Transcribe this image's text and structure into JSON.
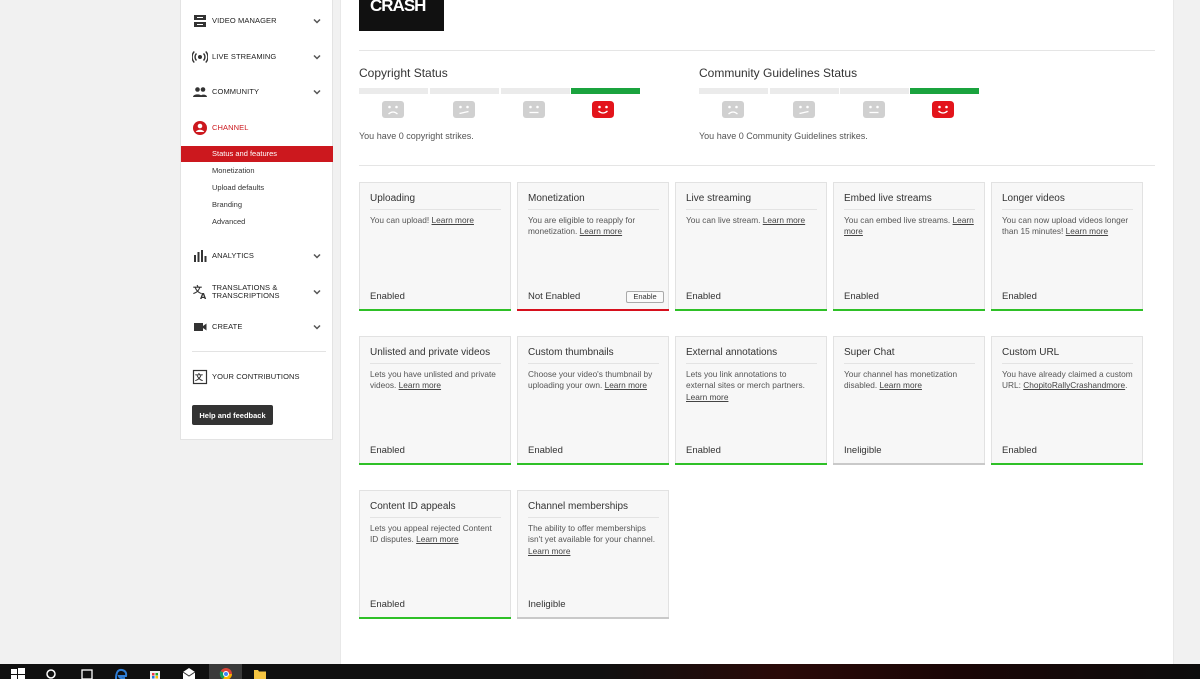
{
  "sidebar": {
    "items": [
      {
        "key": "video-manager",
        "label": "VIDEO MANAGER",
        "icon": "video-manager-icon",
        "expandable": true
      },
      {
        "key": "live-streaming",
        "label": "LIVE STREAMING",
        "icon": "live-streaming-icon",
        "expandable": true
      },
      {
        "key": "community",
        "label": "COMMUNITY",
        "icon": "community-icon",
        "expandable": true
      },
      {
        "key": "channel",
        "label": "CHANNEL",
        "icon": "channel-icon",
        "expandable": false,
        "active": true
      },
      {
        "key": "analytics",
        "label": "ANALYTICS",
        "icon": "analytics-icon",
        "expandable": true
      },
      {
        "key": "translations",
        "label": "TRANSLATIONS & TRANSCRIPTIONS",
        "icon": "translate-icon",
        "expandable": true
      },
      {
        "key": "create",
        "label": "CREATE",
        "icon": "create-icon",
        "expandable": true
      }
    ],
    "channel_subitems": [
      {
        "label": "Status and features",
        "active": true
      },
      {
        "label": "Monetization"
      },
      {
        "label": "Upload defaults"
      },
      {
        "label": "Branding"
      },
      {
        "label": "Advanced"
      }
    ],
    "contributions_label": "YOUR CONTRIBUTIONS",
    "help_button": "Help and feedback"
  },
  "main": {
    "logo_text": "CRASH",
    "copyright": {
      "title": "Copyright Status",
      "text": "You have 0 copyright strikes."
    },
    "community_guidelines": {
      "title": "Community Guidelines Status",
      "text": "You have 0 Community Guidelines strikes."
    },
    "cards": [
      {
        "title": "Uploading",
        "desc": "You can upload!",
        "link": "Learn more",
        "status": "Enabled",
        "state": "enabled"
      },
      {
        "title": "Monetization",
        "desc": "You are eligible to reapply for monetization.",
        "link": "Learn more",
        "status": "Not Enabled",
        "state": "notenabled",
        "button": "Enable"
      },
      {
        "title": "Live streaming",
        "desc": "You can live stream.",
        "link": "Learn more",
        "status": "Enabled",
        "state": "enabled"
      },
      {
        "title": "Embed live streams",
        "desc": "You can embed live streams.",
        "link": "Learn more",
        "status": "Enabled",
        "state": "enabled"
      },
      {
        "title": "Longer videos",
        "desc": "You can now upload videos longer than 15 minutes!",
        "link": "Learn more",
        "status": "Enabled",
        "state": "enabled"
      },
      {
        "title": "Unlisted and private videos",
        "desc": "Lets you have unlisted and private videos.",
        "link": "Learn more",
        "status": "Enabled",
        "state": "enabled"
      },
      {
        "title": "Custom thumbnails",
        "desc": "Choose your video's thumbnail by uploading your own.",
        "link": "Learn more",
        "status": "Enabled",
        "state": "enabled"
      },
      {
        "title": "External annotations",
        "desc": "Lets you link annotations to external sites or merch partners.",
        "link": "Learn more",
        "status": "Enabled",
        "state": "enabled"
      },
      {
        "title": "Super Chat",
        "desc": "Your channel has monetization disabled.",
        "link": "Learn more",
        "status": "Ineligible",
        "state": "ineligible"
      },
      {
        "title": "Custom URL",
        "desc": "You have already claimed a custom URL:",
        "link": "ChopitoRallyCrashandmore",
        "suffix": ".",
        "status": "Enabled",
        "state": "enabled"
      },
      {
        "title": "Content ID appeals",
        "desc": "Lets you appeal rejected Content ID disputes.",
        "link": "Learn more",
        "status": "Enabled",
        "state": "enabled"
      },
      {
        "title": "Channel memberships",
        "desc": "The ability to offer memberships isn't yet available for your channel.",
        "link": "Learn more",
        "status": "Ineligible",
        "state": "ineligible"
      }
    ]
  },
  "colors": {
    "accent_red": "#cc181e",
    "enabled_green": "#2ec027",
    "status_green": "#1aa33e",
    "not_enabled_red": "#d6101d",
    "ineligible_gray": "#c9c9c9"
  },
  "taskbar": {
    "icons": [
      "windows-start-icon",
      "search-icon",
      "task-view-icon",
      "edge-browser-icon",
      "store-icon",
      "mail-icon",
      "chrome-icon",
      "file-explorer-icon"
    ]
  }
}
